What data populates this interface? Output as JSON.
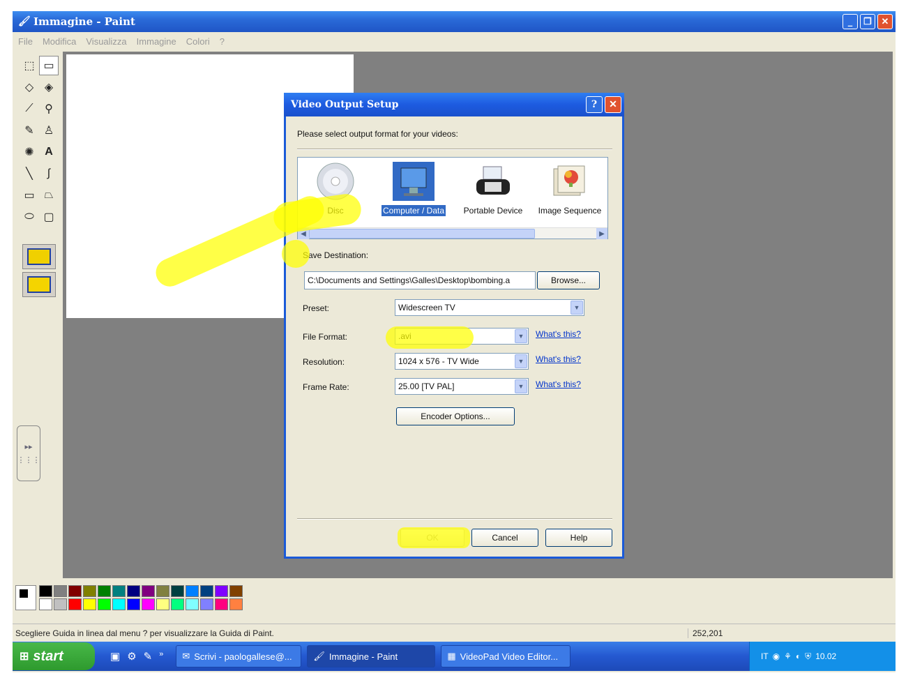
{
  "paint": {
    "title": "Immagine - Paint",
    "menu": [
      "File",
      "Modifica",
      "Visualizza",
      "Immagine",
      "Colori",
      "?"
    ],
    "status_text": "Scegliere Guida in linea dal menu ? per visualizzare la Guida di Paint.",
    "status_coords": "252,201",
    "palette_top": [
      "#000000",
      "#808080",
      "#800000",
      "#808000",
      "#008000",
      "#008080",
      "#000080",
      "#800080",
      "#808040",
      "#004040",
      "#0080ff",
      "#004080",
      "#8000ff",
      "#804000"
    ],
    "palette_bottom": [
      "#ffffff",
      "#c0c0c0",
      "#ff0000",
      "#ffff00",
      "#00ff00",
      "#00ffff",
      "#0000ff",
      "#ff00ff",
      "#ffff80",
      "#00ff80",
      "#80ffff",
      "#8080ff",
      "#ff0080",
      "#ff8040"
    ]
  },
  "dialog": {
    "title": "Video Output Setup",
    "help_label": "?",
    "close_label": "✕",
    "prompt": "Please select output format for your videos:",
    "formats": [
      {
        "label": "Disc",
        "icon": "disc-icon"
      },
      {
        "label": "Computer / Data",
        "icon": "computer-icon",
        "selected": true
      },
      {
        "label": "Portable Device",
        "icon": "portable-device-icon"
      },
      {
        "label": "Image Sequence",
        "icon": "image-sequence-icon"
      }
    ],
    "save_destination_label": "Save Destination:",
    "save_destination_value": "C:\\Documents and Settings\\Galles\\Desktop\\bombing.a",
    "browse_label": "Browse...",
    "preset_label": "Preset:",
    "preset_value": "Widescreen TV",
    "file_format_label": "File Format:",
    "file_format_value": ".avi",
    "resolution_label": "Resolution:",
    "resolution_value": "1024 x 576 - TV Wide",
    "frame_rate_label": "Frame Rate:",
    "frame_rate_value": "25.00 [TV PAL]",
    "whats_this_label": "What's this?",
    "encoder_options_label": "Encoder Options...",
    "ok_label": "OK",
    "cancel_label": "Cancel",
    "help_button_label": "Help"
  },
  "taskbar": {
    "start_label": "start",
    "tasks": [
      {
        "label": "Scrivi - paologallese@...",
        "icon": "email-icon"
      },
      {
        "label": "Immagine - Paint",
        "icon": "paint-icon"
      },
      {
        "label": "VideoPad Video Editor...",
        "icon": "videopad-icon"
      }
    ],
    "language": "IT",
    "clock": "10.02"
  }
}
